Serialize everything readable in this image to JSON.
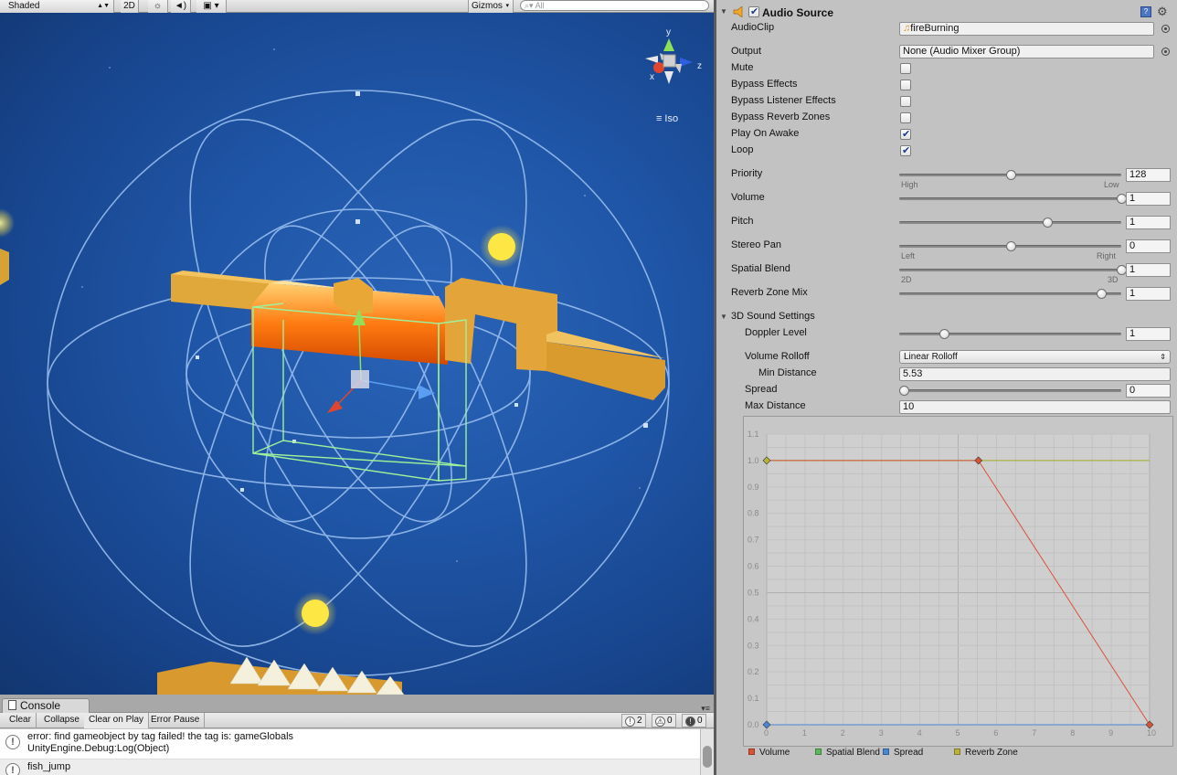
{
  "scene": {
    "toolbar": {
      "shading_mode": "Shaded",
      "mode_2d": "2D",
      "gizmos_label": "Gizmos",
      "search_placeholder": "All"
    },
    "projection_label": "Iso",
    "axis_labels": {
      "x": "x",
      "y": "y",
      "z": "z"
    }
  },
  "console": {
    "tab_label": "Console",
    "buttons": {
      "clear": "Clear",
      "collapse": "Collapse",
      "clear_on_play": "Clear on Play",
      "error_pause": "Error Pause"
    },
    "counts": {
      "info": "2",
      "warnings": "0",
      "errors": "0"
    },
    "logs": [
      {
        "line1": "error: find gameobject by tag failed! the tag is: gameGlobals",
        "line2": "UnityEngine.Debug:Log(Object)"
      },
      {
        "line1": "fish_jump",
        "line2": ""
      }
    ]
  },
  "inspector": {
    "component_title": "Audio Source",
    "component_enabled": true,
    "audio_clip": {
      "label": "AudioClip",
      "value": "fireBurning"
    },
    "output": {
      "label": "Output",
      "value": "None (Audio Mixer Group)"
    },
    "toggles": [
      {
        "label": "Mute",
        "checked": false
      },
      {
        "label": "Bypass Effects",
        "checked": false
      },
      {
        "label": "Bypass Listener Effects",
        "checked": false
      },
      {
        "label": "Bypass Reverb Zones",
        "checked": false
      },
      {
        "label": "Play On Awake",
        "checked": true
      },
      {
        "label": "Loop",
        "checked": true
      }
    ],
    "sliders": [
      {
        "label": "Priority",
        "value": "128",
        "fraction": 0.5,
        "min_label": "High",
        "max_label": "Low"
      },
      {
        "label": "Volume",
        "value": "1",
        "fraction": 1.0
      },
      {
        "label": "Pitch",
        "value": "1",
        "fraction": 0.667
      },
      {
        "label": "Stereo Pan",
        "value": "0",
        "fraction": 0.5,
        "min_label": "Left",
        "max_label": "Right"
      },
      {
        "label": "Spatial Blend",
        "value": "1",
        "fraction": 1.0,
        "min_label": "2D",
        "max_label": "3D"
      },
      {
        "label": "Reverb Zone Mix",
        "value": "1",
        "fraction": 0.909
      }
    ],
    "sound3d": {
      "label": "3D Sound Settings",
      "doppler": {
        "label": "Doppler Level",
        "value": "1",
        "fraction": 0.2
      },
      "rolloff": {
        "label": "Volume Rolloff",
        "value": "Linear Rolloff"
      },
      "min_distance": {
        "label": "Min Distance",
        "value": "5.53"
      },
      "spread": {
        "label": "Spread",
        "value": "0",
        "fraction": 0.0
      },
      "max_distance": {
        "label": "Max Distance",
        "value": "10"
      }
    }
  },
  "chart_data": {
    "type": "line",
    "x_ticks": [
      "0",
      "1",
      "2",
      "3",
      "4",
      "5",
      "6",
      "7",
      "8",
      "9",
      "10"
    ],
    "y_ticks": [
      "0.0",
      "0.1",
      "0.2",
      "0.3",
      "0.4",
      "0.5",
      "0.6",
      "0.7",
      "0.8",
      "0.9",
      "1.0",
      "1.1"
    ],
    "xlim": [
      0,
      10
    ],
    "ylim": [
      0,
      1.1
    ],
    "series": [
      {
        "name": "Volume",
        "color": "#d9533b",
        "points": [
          [
            0,
            1.0
          ],
          [
            5.53,
            1.0
          ],
          [
            10,
            0.0
          ]
        ]
      },
      {
        "name": "Spatial Blend",
        "color": "#5cb85c",
        "points": [
          [
            0,
            1.0
          ],
          [
            10,
            1.0
          ]
        ]
      },
      {
        "name": "Spread",
        "color": "#4a86d4",
        "points": [
          [
            0,
            0.0
          ],
          [
            10,
            0.0
          ]
        ]
      },
      {
        "name": "Reverb Zone",
        "color": "#b9b339",
        "points": [
          [
            0,
            1.0
          ],
          [
            10,
            1.0
          ]
        ]
      }
    ],
    "grid": true,
    "legend_placement": "bottom"
  }
}
